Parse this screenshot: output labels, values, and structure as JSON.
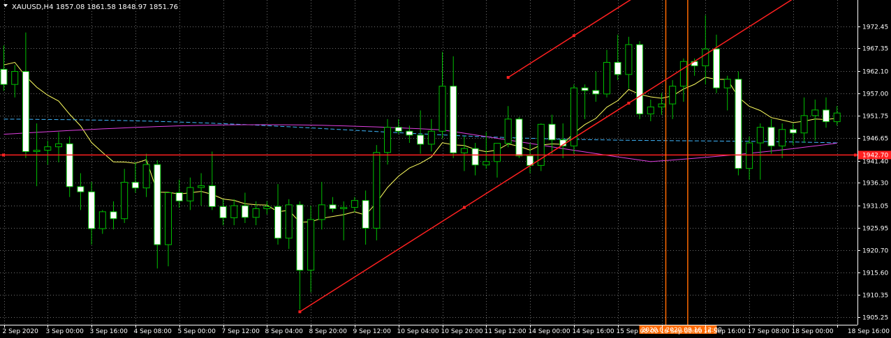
{
  "chart_data": {
    "type": "candlestick",
    "symbol_label": "XAUUSD,H4",
    "ohlc_label": "1857.08 1861.58 1848.97 1851.76",
    "ylim": [
      1903.5,
      1978.5
    ],
    "y_ticks": [
      "1972.45",
      "1967.35",
      "1962.10",
      "1957.00",
      "1951.75",
      "1946.65",
      "1941.40",
      "1936.30",
      "1931.05",
      "1925.95",
      "1920.70",
      "1915.60",
      "1910.35",
      "1905.25"
    ],
    "x_ticks": [
      "2 Sep 2020",
      "3 Sep 00:00",
      "3 Sep 16:00",
      "4 Sep 08:00",
      "5 Sep 00:00",
      "7 Sep 12:00",
      "8 Sep 04:00",
      "8 Sep 20:00",
      "9 Sep 12:00",
      "10 Sep 04:00",
      "10 Sep 20:00",
      "11 Sep 12:00",
      "14 Sep 00:00",
      "14 Sep 16:00",
      "15 Sep 08:00",
      "16 Sep 00:00",
      "16 Sep 16:00",
      "17 Sep 08:00",
      "18 Sep 00:00",
      "18 Sep 16:00"
    ],
    "horizontal_line": {
      "price": 1942.7,
      "label": "1942.70",
      "color": "#ff2020"
    },
    "vertical_lines": [
      {
        "bar": 60,
        "label": "2020.0"
      },
      {
        "bar": 62,
        "label": "2020.09.16 12:00"
      }
    ],
    "channel": {
      "start": [
        27,
        1906.5
      ],
      "end": [
        75,
        1983.6
      ],
      "offset": 23.6
    },
    "colors": {
      "bull_body": "#000000",
      "bear_body": "#ffffff",
      "wick": "#00c000",
      "ma_fast": "#ffff60",
      "ma_mid": "#40b8ff",
      "ma_slow": "#e040e0",
      "trend": "#ff2020",
      "vline": "#ff6a00",
      "axis_text": "#ffffff"
    },
    "candles": [
      [
        1962.5,
        1968,
        1957.5,
        1959
      ],
      [
        1959,
        1963.5,
        1956,
        1962
      ],
      [
        1962,
        1971,
        1942,
        1943.5
      ],
      [
        1943.5,
        1950,
        1935.5,
        1943.8
      ],
      [
        1943.8,
        1946,
        1940.5,
        1944.6
      ],
      [
        1944.6,
        1948,
        1941,
        1945.3
      ],
      [
        1945.3,
        1947,
        1933,
        1935.4
      ],
      [
        1935.4,
        1938.5,
        1930,
        1934.2
      ],
      [
        1934.2,
        1936.5,
        1922,
        1925.7
      ],
      [
        1925.7,
        1930,
        1924.5,
        1929.6
      ],
      [
        1929.6,
        1932,
        1925.5,
        1928
      ],
      [
        1928,
        1939.5,
        1927,
        1936.4
      ],
      [
        1936.4,
        1941,
        1934,
        1935.1
      ],
      [
        1935.1,
        1943,
        1933,
        1940.5
      ],
      [
        1940.5,
        1941.5,
        1916.5,
        1922
      ],
      [
        1922,
        1929,
        1917,
        1934
      ],
      [
        1934,
        1937,
        1930.5,
        1932.1
      ],
      [
        1932.1,
        1937.5,
        1930,
        1935.2
      ],
      [
        1935.2,
        1938.5,
        1931,
        1935.6
      ],
      [
        1935.6,
        1943.5,
        1930,
        1930.8
      ],
      [
        1930.8,
        1932.5,
        1926.5,
        1928.2
      ],
      [
        1928.2,
        1932.5,
        1926.5,
        1931
      ],
      [
        1931,
        1934,
        1927,
        1928.3
      ],
      [
        1928.3,
        1932,
        1926.5,
        1930.3
      ],
      [
        1930.3,
        1932,
        1929,
        1930.8
      ],
      [
        1930.8,
        1936,
        1922,
        1923.5
      ],
      [
        1923.5,
        1932.5,
        1921,
        1931.2
      ],
      [
        1931.2,
        1932,
        1907,
        1916.1
      ],
      [
        1916.1,
        1931,
        1911,
        1927.8
      ],
      [
        1927.8,
        1936.5,
        1925.5,
        1931.2
      ],
      [
        1931.2,
        1933,
        1929.5,
        1930.3
      ],
      [
        1930.3,
        1932,
        1923,
        1930.6
      ],
      [
        1930.6,
        1933,
        1929.5,
        1932.2
      ],
      [
        1932.2,
        1934.5,
        1922,
        1925.8
      ],
      [
        1925.8,
        1945,
        1923,
        1943.3
      ],
      [
        1943.3,
        1951,
        1940.5,
        1949.1
      ],
      [
        1949.1,
        1951,
        1947.5,
        1948.2
      ],
      [
        1948.2,
        1949.5,
        1945.5,
        1947.3
      ],
      [
        1947.3,
        1953,
        1943,
        1945.2
      ],
      [
        1945.2,
        1951,
        1943.5,
        1948.2
      ],
      [
        1948.2,
        1966.5,
        1946.5,
        1958.6
      ],
      [
        1958.6,
        1965.5,
        1942,
        1943.2
      ],
      [
        1943.2,
        1947,
        1939,
        1944.2
      ],
      [
        1944.2,
        1945.5,
        1938,
        1940.4
      ],
      [
        1940.4,
        1948,
        1939.5,
        1941.2
      ],
      [
        1941.2,
        1944,
        1937.5,
        1945.4
      ],
      [
        1945.4,
        1954,
        1944.5,
        1951
      ],
      [
        1951,
        1951.5,
        1942,
        1942.5
      ],
      [
        1942.5,
        1945.5,
        1938.5,
        1940.3
      ],
      [
        1940.3,
        1950,
        1939,
        1949.8
      ],
      [
        1949.8,
        1952,
        1943,
        1946.2
      ],
      [
        1946.2,
        1950,
        1942,
        1944.8
      ],
      [
        1944.8,
        1959,
        1943,
        1958.2
      ],
      [
        1958.2,
        1959,
        1951,
        1957.6
      ],
      [
        1957.6,
        1962,
        1955,
        1956.8
      ],
      [
        1956.8,
        1967,
        1956,
        1964.1
      ],
      [
        1964.1,
        1970.5,
        1960,
        1961.3
      ],
      [
        1961.3,
        1970,
        1958,
        1968.2
      ],
      [
        1968.2,
        1969,
        1951,
        1952.2
      ],
      [
        1952.2,
        1955.5,
        1950.5,
        1953.8
      ],
      [
        1953.8,
        1957,
        1952,
        1954.5
      ],
      [
        1954.5,
        1960,
        1951,
        1958.6
      ],
      [
        1958.6,
        1965,
        1955,
        1964.3
      ],
      [
        1964.3,
        1965,
        1961,
        1963.3
      ],
      [
        1963.3,
        1975,
        1959,
        1967.2
      ],
      [
        1967.2,
        1970.5,
        1957,
        1958.2
      ],
      [
        1958.2,
        1961,
        1953,
        1960.2
      ],
      [
        1960.2,
        1962,
        1938,
        1939.6
      ],
      [
        1939.6,
        1947,
        1937,
        1945.5
      ],
      [
        1945.5,
        1950,
        1937,
        1949.1
      ],
      [
        1949.1,
        1951,
        1943,
        1944.8
      ],
      [
        1944.8,
        1950,
        1942,
        1948.6
      ],
      [
        1948.6,
        1950,
        1945,
        1947.8
      ],
      [
        1947.8,
        1956,
        1945.5,
        1951.8
      ],
      [
        1951.8,
        1955.5,
        1946,
        1953.1
      ],
      [
        1953.1,
        1956,
        1949,
        1950.4
      ],
      [
        1950.4,
        1954,
        1949.5,
        1952.4
      ]
    ]
  }
}
